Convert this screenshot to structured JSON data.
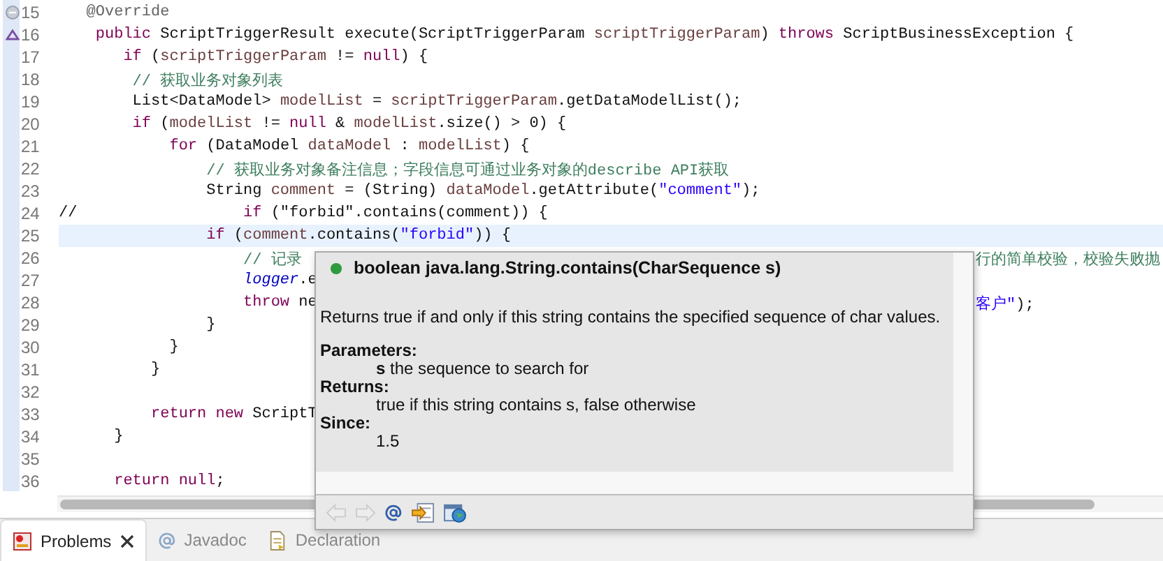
{
  "editor": {
    "lines": [
      {
        "number": "15",
        "kind": "fold",
        "current": false,
        "tokens": [
          {
            "text": "   @Override",
            "kind": "annotation"
          }
        ]
      },
      {
        "number": "16",
        "kind": "override",
        "current": false,
        "tokens": [
          {
            "text": "    public",
            "kind": "keyword"
          },
          {
            "text": " ScriptTriggerResult execute(ScriptTriggerParam ",
            "kind": "plain"
          },
          {
            "text": "scriptTriggerParam",
            "kind": "param"
          },
          {
            "text": ") ",
            "kind": "plain"
          },
          {
            "text": "throws",
            "kind": "keyword"
          },
          {
            "text": " ScriptBusinessException {",
            "kind": "plain"
          }
        ]
      },
      {
        "number": "17",
        "kind": "code",
        "current": false,
        "tokens": [
          {
            "text": "       if",
            "kind": "keyword"
          },
          {
            "text": " (",
            "kind": "plain"
          },
          {
            "text": "scriptTriggerParam",
            "kind": "param"
          },
          {
            "text": " != ",
            "kind": "plain"
          },
          {
            "text": "null",
            "kind": "keyword"
          },
          {
            "text": ") {",
            "kind": "plain"
          }
        ]
      },
      {
        "number": "18",
        "kind": "code",
        "current": false,
        "tokens": [
          {
            "text": "        // 获取业务对象列表",
            "kind": "comment"
          }
        ]
      },
      {
        "number": "19",
        "kind": "code",
        "current": false,
        "tokens": [
          {
            "text": "        List<DataModel> ",
            "kind": "plain"
          },
          {
            "text": "modelList",
            "kind": "local"
          },
          {
            "text": " = ",
            "kind": "plain"
          },
          {
            "text": "scriptTriggerParam",
            "kind": "param"
          },
          {
            "text": ".getDataModelList();",
            "kind": "plain"
          }
        ]
      },
      {
        "number": "20",
        "kind": "code",
        "current": false,
        "tokens": [
          {
            "text": "        if",
            "kind": "keyword"
          },
          {
            "text": " (",
            "kind": "plain"
          },
          {
            "text": "modelList",
            "kind": "local"
          },
          {
            "text": " != ",
            "kind": "plain"
          },
          {
            "text": "null",
            "kind": "keyword"
          },
          {
            "text": " & ",
            "kind": "plain"
          },
          {
            "text": "modelList",
            "kind": "local"
          },
          {
            "text": ".size() > 0) {",
            "kind": "plain"
          }
        ]
      },
      {
        "number": "21",
        "kind": "code",
        "current": false,
        "tokens": [
          {
            "text": "            for",
            "kind": "keyword"
          },
          {
            "text": " (DataModel ",
            "kind": "plain"
          },
          {
            "text": "dataModel",
            "kind": "local"
          },
          {
            "text": " : ",
            "kind": "plain"
          },
          {
            "text": "modelList",
            "kind": "local"
          },
          {
            "text": ") {",
            "kind": "plain"
          }
        ]
      },
      {
        "number": "22",
        "kind": "code",
        "current": false,
        "tokens": [
          {
            "text": "                // 获取业务对象备注信息；字段信息可通过业务对象的describe API获取",
            "kind": "comment"
          }
        ]
      },
      {
        "number": "23",
        "kind": "code",
        "current": false,
        "tokens": [
          {
            "text": "                String ",
            "kind": "plain"
          },
          {
            "text": "comment",
            "kind": "local"
          },
          {
            "text": " = (String) ",
            "kind": "plain"
          },
          {
            "text": "dataModel",
            "kind": "local"
          },
          {
            "text": ".getAttribute(",
            "kind": "plain"
          },
          {
            "text": "\"comment\"",
            "kind": "string"
          },
          {
            "text": ");",
            "kind": "plain"
          }
        ]
      },
      {
        "number": "24",
        "kind": "code",
        "current": false,
        "tokens": [
          {
            "text": "//                  ",
            "kind": "plain"
          },
          {
            "text": "if",
            "kind": "keyword"
          },
          {
            "text": " (\"forbid\".contains(comment)) {",
            "kind": "plain"
          }
        ]
      },
      {
        "number": "25",
        "kind": "code",
        "current": true,
        "tokens": [
          {
            "text": "                if",
            "kind": "keyword"
          },
          {
            "text": " (",
            "kind": "plain"
          },
          {
            "text": "comment",
            "kind": "local"
          },
          {
            "text": ".contains(",
            "kind": "plain"
          },
          {
            "text": "\"forbid\"",
            "kind": "string"
          },
          {
            "text": ")) {",
            "kind": "plain"
          }
        ]
      },
      {
        "number": "26",
        "kind": "code",
        "current": false,
        "tokens": [
          {
            "text": "                    // 记录",
            "kind": "comment"
          }
        ],
        "right_tokens": [
          {
            "text": "行的简单校验，校验失败抛",
            "kind": "comment"
          }
        ]
      },
      {
        "number": "27",
        "kind": "code",
        "current": false,
        "tokens": [
          {
            "text": "                    logger",
            "kind": "field"
          },
          {
            "text": ".e",
            "kind": "plain"
          }
        ]
      },
      {
        "number": "28",
        "kind": "code",
        "current": false,
        "tokens": [
          {
            "text": "                    throw",
            "kind": "keyword"
          },
          {
            "text": " ne",
            "kind": "plain"
          }
        ],
        "right_tokens": [
          {
            "text": "客户\"",
            "kind": "string"
          },
          {
            "text": ");",
            "kind": "plain"
          }
        ]
      },
      {
        "number": "29",
        "kind": "code",
        "current": false,
        "tokens": [
          {
            "text": "                }",
            "kind": "plain"
          }
        ]
      },
      {
        "number": "30",
        "kind": "code",
        "current": false,
        "tokens": [
          {
            "text": "            }",
            "kind": "plain"
          }
        ]
      },
      {
        "number": "31",
        "kind": "code",
        "current": false,
        "tokens": [
          {
            "text": "          }",
            "kind": "plain"
          }
        ]
      },
      {
        "number": "32",
        "kind": "code",
        "current": false
      },
      {
        "number": "33",
        "kind": "code",
        "current": false,
        "tokens": [
          {
            "text": "          return",
            "kind": "keyword"
          },
          {
            "text": " new",
            "kind": "keyword"
          },
          {
            "text": " ScriptT",
            "kind": "plain"
          }
        ]
      },
      {
        "number": "34",
        "kind": "code",
        "current": false,
        "tokens": [
          {
            "text": "      }",
            "kind": "plain"
          }
        ]
      },
      {
        "number": "35",
        "kind": "code",
        "current": false
      },
      {
        "number": "36",
        "kind": "code",
        "current": false,
        "tokens": [
          {
            "text": "      return",
            "kind": "keyword"
          },
          {
            "text": " null",
            "kind": "keyword"
          },
          {
            "text": ";",
            "kind": "plain"
          }
        ]
      }
    ]
  },
  "hover": {
    "signature": "boolean java.lang.String.contains(CharSequence s)",
    "description": "Returns true if and only if this string contains the specified sequence of char values.",
    "sections": [
      {
        "heading": "Parameters:",
        "body": "**s** the sequence to search for"
      },
      {
        "heading": "Returns:",
        "body": "true if this string contains s, false otherwise"
      },
      {
        "heading": "Since:",
        "body": "1.5"
      }
    ],
    "toolbar": [
      {
        "kind": "back",
        "disabled": true
      },
      {
        "kind": "forward",
        "disabled": true
      },
      {
        "kind": "at",
        "disabled": false
      },
      {
        "kind": "open",
        "disabled": false
      },
      {
        "kind": "browser",
        "disabled": false
      }
    ]
  },
  "bottom_tabs": [
    {
      "label": "Problems",
      "selected": true
    },
    {
      "label": "Javadoc",
      "selected": false
    },
    {
      "label": "Declaration",
      "selected": false
    }
  ]
}
